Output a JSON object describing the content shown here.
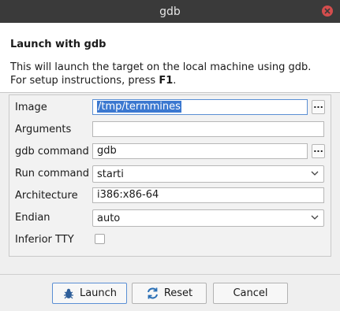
{
  "window": {
    "title": "gdb"
  },
  "header": {
    "title": "Launch with gdb",
    "desc_line1": "This will launch the target on the local machine using gdb.",
    "desc_line2_prefix": "For setup instructions, press ",
    "desc_line2_key": "F1",
    "desc_line2_suffix": "."
  },
  "form": {
    "image": {
      "label": "Image",
      "value": "/tmp/termmines"
    },
    "arguments": {
      "label": "Arguments",
      "value": ""
    },
    "gdb_command": {
      "label": "gdb command",
      "value": "gdb"
    },
    "run_command": {
      "label": "Run command",
      "value": "starti"
    },
    "architecture": {
      "label": "Architecture",
      "value": "i386:x86-64"
    },
    "endian": {
      "label": "Endian",
      "value": "auto"
    },
    "inferior_tty": {
      "label": "Inferior TTY",
      "checked": false
    },
    "browse_label": "..."
  },
  "buttons": {
    "launch": "Launch",
    "reset": "Reset",
    "cancel": "Cancel"
  },
  "icons": {
    "close": "close-icon",
    "launch": "bug-icon",
    "reset": "refresh-icon",
    "dropdown": "chevron-down-icon"
  }
}
